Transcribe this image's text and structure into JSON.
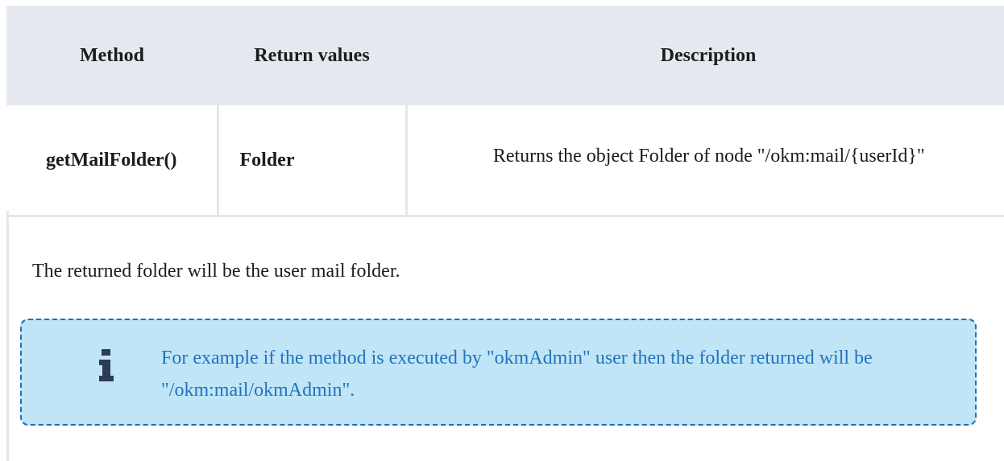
{
  "table": {
    "headers": [
      "Method",
      "Return values",
      "Description"
    ],
    "rows": [
      {
        "method": "getMailFolder()",
        "return_value": "Folder",
        "description": "Returns the object Folder of node \"/okm:mail/{userId}\""
      }
    ]
  },
  "paragraph": "The returned folder will be the user mail folder.",
  "note": {
    "icon": "info-icon",
    "text": "For example if the method is executed by \"okmAdmin\" user then the folder returned will be \"/okm:mail/okmAdmin\"."
  },
  "colors": {
    "header_bg": "#e5e9ef",
    "note_bg": "#bfe5f7",
    "note_border": "#236db8",
    "note_text": "#2473bd"
  }
}
